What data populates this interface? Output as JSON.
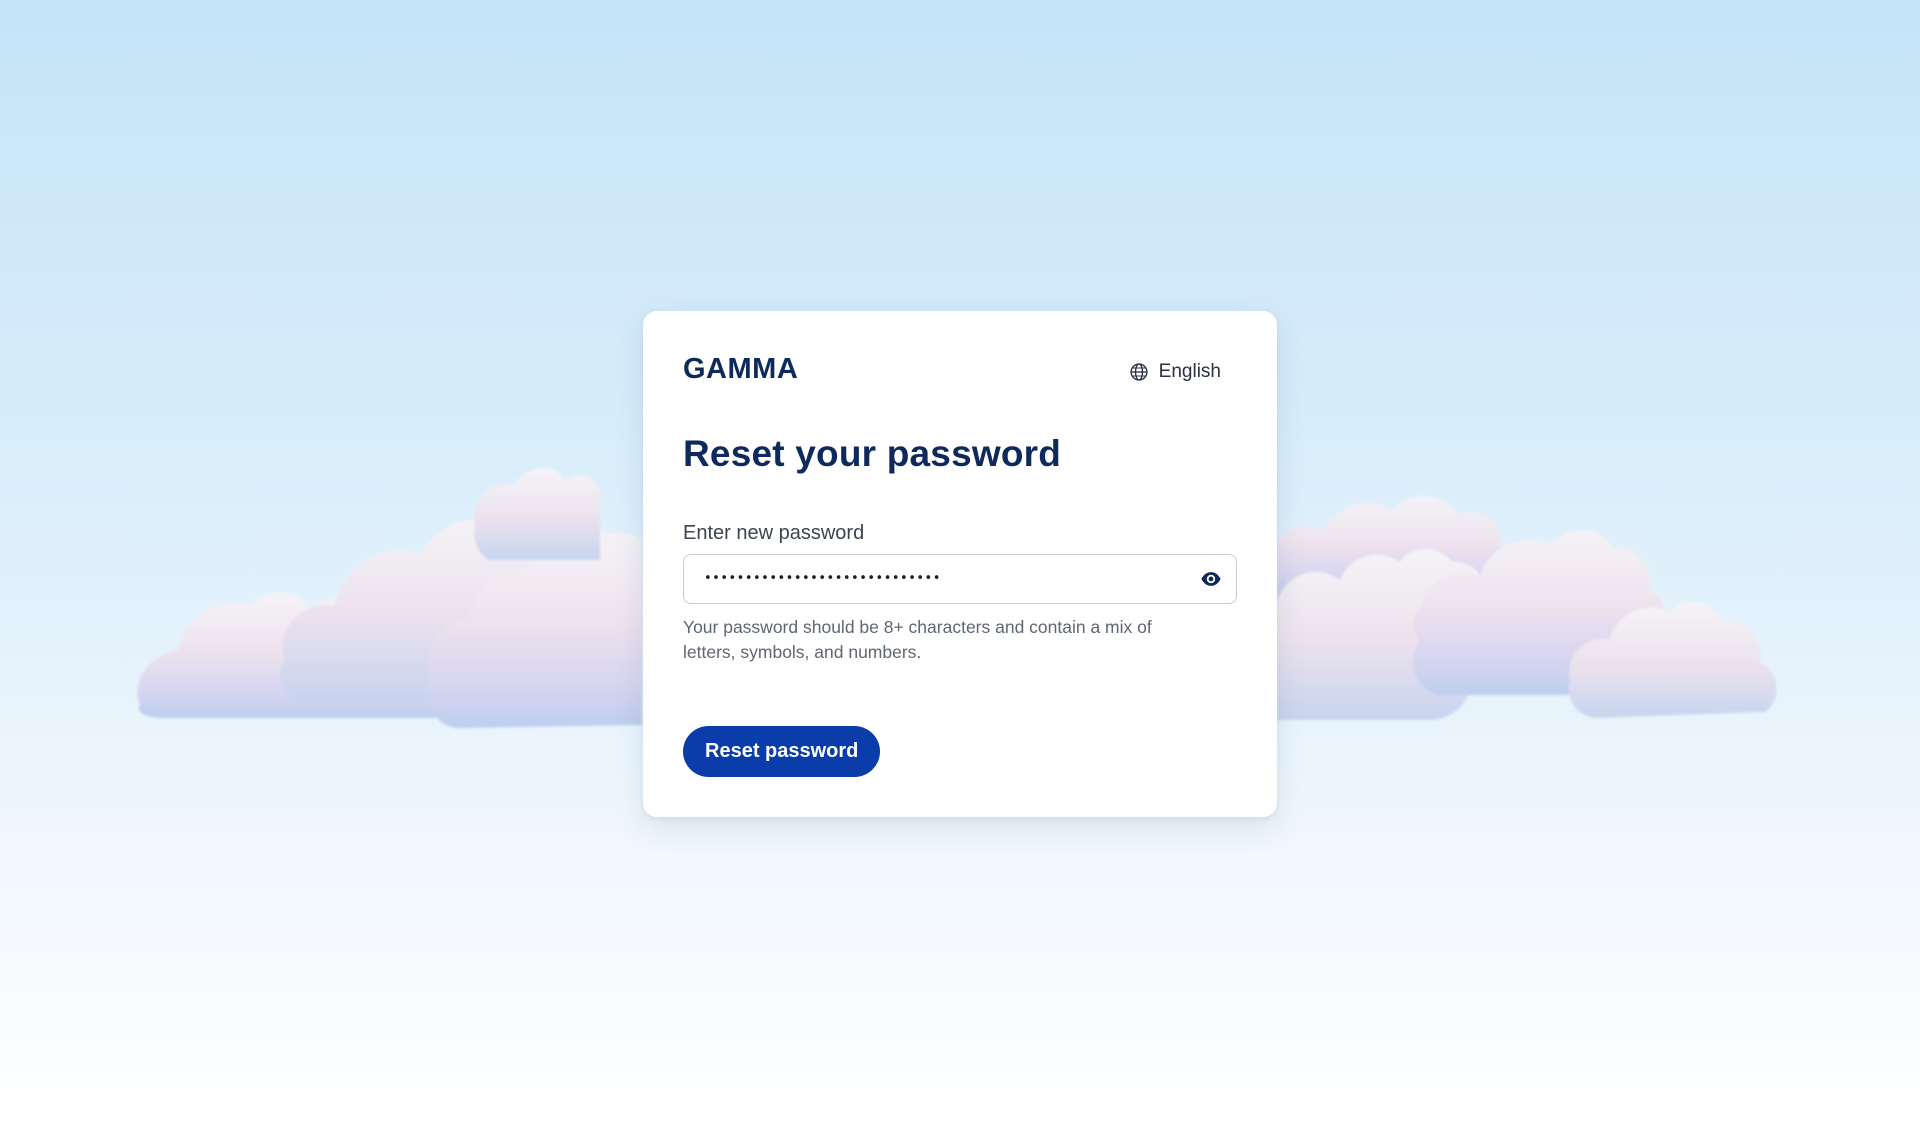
{
  "brand": {
    "logo_text": "GAMMA",
    "logo_color": "#0e2a5c"
  },
  "language": {
    "label": "English",
    "icon": "globe-icon"
  },
  "form": {
    "title": "Reset your password",
    "password_label": "Enter new password",
    "password_value": "•••••••••••••••••••••••••••••",
    "visibility_icon": "eye-icon",
    "hint": "Your password should be 8+ characters and contain a mix of letters, symbols, and numbers.",
    "submit_label": "Reset password"
  },
  "colors": {
    "primary": "#0a3caa",
    "heading": "#0e2a5c",
    "background_top": "#c5e4f8",
    "background_bottom": "#ffffff"
  }
}
